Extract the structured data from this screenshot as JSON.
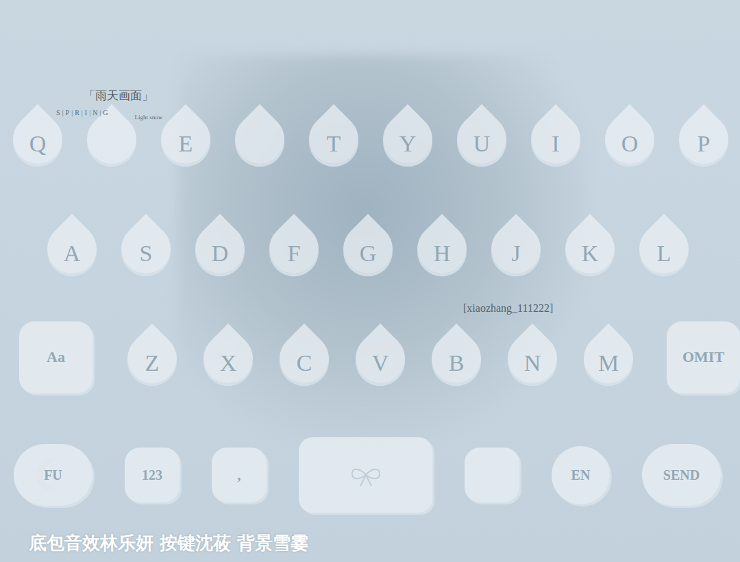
{
  "logo": {
    "title": "「雨天画面」",
    "subtitle": "S|P|R|I|N|G",
    "tag": "Light snow"
  },
  "watermark": "[xiaozhang_111222]",
  "keyboard": {
    "rows": [
      [
        {
          "label": "Q",
          "kind": "drop"
        },
        {
          "label": "",
          "kind": "drop"
        },
        {
          "label": "E",
          "kind": "drop"
        },
        {
          "label": "",
          "kind": "drop"
        },
        {
          "label": "T",
          "kind": "drop"
        },
        {
          "label": "Y",
          "kind": "drop"
        },
        {
          "label": "U",
          "kind": "drop"
        },
        {
          "label": "I",
          "kind": "drop"
        },
        {
          "label": "O",
          "kind": "drop"
        },
        {
          "label": "P",
          "kind": "drop"
        }
      ],
      [
        {
          "label": "A",
          "kind": "drop"
        },
        {
          "label": "S",
          "kind": "drop"
        },
        {
          "label": "D",
          "kind": "drop"
        },
        {
          "label": "F",
          "kind": "drop"
        },
        {
          "label": "G",
          "kind": "drop"
        },
        {
          "label": "H",
          "kind": "drop"
        },
        {
          "label": "J",
          "kind": "drop"
        },
        {
          "label": "K",
          "kind": "drop"
        },
        {
          "label": "L",
          "kind": "drop"
        }
      ],
      [
        {
          "label": "Aa",
          "kind": "box"
        },
        {
          "label": "Z",
          "kind": "drop"
        },
        {
          "label": "X",
          "kind": "drop"
        },
        {
          "label": "C",
          "kind": "drop"
        },
        {
          "label": "V",
          "kind": "drop"
        },
        {
          "label": "B",
          "kind": "drop"
        },
        {
          "label": "N",
          "kind": "drop"
        },
        {
          "label": "M",
          "kind": "drop"
        },
        {
          "label": "OMIT",
          "kind": "box"
        }
      ],
      [
        {
          "label": "FU",
          "kind": "moon"
        },
        {
          "label": "123",
          "kind": "small"
        },
        {
          "label": ",",
          "kind": "small"
        },
        {
          "label": "",
          "kind": "space"
        },
        {
          "label": "",
          "kind": "small"
        },
        {
          "label": "EN",
          "kind": "round"
        },
        {
          "label": "SEND",
          "kind": "star"
        }
      ]
    ]
  },
  "caption": "底包音效林乐妍 按键沈莜 背景雪霎"
}
